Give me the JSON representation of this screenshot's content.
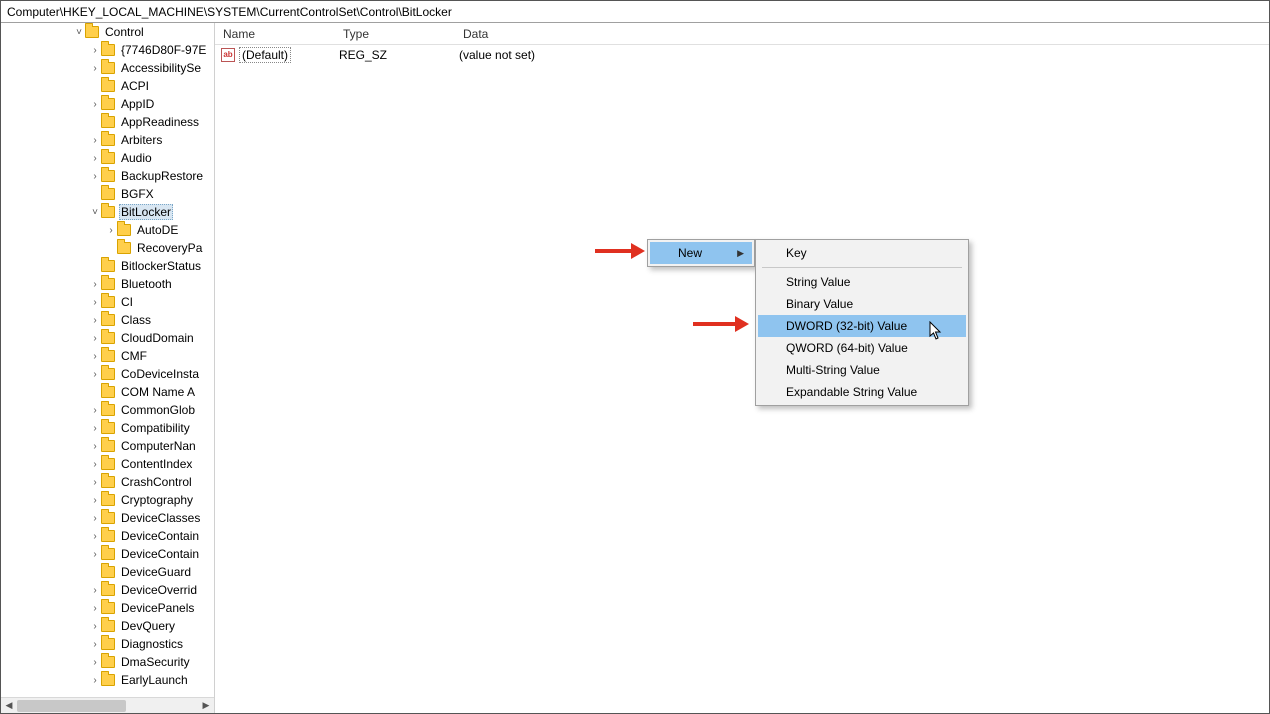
{
  "address": "Computer\\HKEY_LOCAL_MACHINE\\SYSTEM\\CurrentControlSet\\Control\\BitLocker",
  "tree": {
    "root_label": "Control",
    "selected_label": "BitLocker",
    "items": [
      {
        "label": "{7746D80F-97E",
        "depth": 3,
        "expand": ">"
      },
      {
        "label": "AccessibilitySe",
        "depth": 3,
        "expand": ">"
      },
      {
        "label": "ACPI",
        "depth": 3,
        "expand": ""
      },
      {
        "label": "AppID",
        "depth": 3,
        "expand": ">"
      },
      {
        "label": "AppReadiness",
        "depth": 3,
        "expand": ""
      },
      {
        "label": "Arbiters",
        "depth": 3,
        "expand": ">"
      },
      {
        "label": "Audio",
        "depth": 3,
        "expand": ">"
      },
      {
        "label": "BackupRestore",
        "depth": 3,
        "expand": ">"
      },
      {
        "label": "BGFX",
        "depth": 3,
        "expand": ""
      },
      {
        "label": "BitLocker",
        "depth": 3,
        "expand": "v",
        "selected": true
      },
      {
        "label": "AutoDE",
        "depth": 4,
        "expand": ">"
      },
      {
        "label": "RecoveryPa",
        "depth": 4,
        "expand": ""
      },
      {
        "label": "BitlockerStatus",
        "depth": 3,
        "expand": ""
      },
      {
        "label": "Bluetooth",
        "depth": 3,
        "expand": ">"
      },
      {
        "label": "CI",
        "depth": 3,
        "expand": ">"
      },
      {
        "label": "Class",
        "depth": 3,
        "expand": ">"
      },
      {
        "label": "CloudDomain",
        "depth": 3,
        "expand": ">"
      },
      {
        "label": "CMF",
        "depth": 3,
        "expand": ">"
      },
      {
        "label": "CoDeviceInsta",
        "depth": 3,
        "expand": ">"
      },
      {
        "label": "COM Name A",
        "depth": 3,
        "expand": ""
      },
      {
        "label": "CommonGlob",
        "depth": 3,
        "expand": ">"
      },
      {
        "label": "Compatibility",
        "depth": 3,
        "expand": ">"
      },
      {
        "label": "ComputerNan",
        "depth": 3,
        "expand": ">"
      },
      {
        "label": "ContentIndex",
        "depth": 3,
        "expand": ">"
      },
      {
        "label": "CrashControl",
        "depth": 3,
        "expand": ">"
      },
      {
        "label": "Cryptography",
        "depth": 3,
        "expand": ">"
      },
      {
        "label": "DeviceClasses",
        "depth": 3,
        "expand": ">"
      },
      {
        "label": "DeviceContain",
        "depth": 3,
        "expand": ">"
      },
      {
        "label": "DeviceContain",
        "depth": 3,
        "expand": ">"
      },
      {
        "label": "DeviceGuard",
        "depth": 3,
        "expand": ""
      },
      {
        "label": "DeviceOverrid",
        "depth": 3,
        "expand": ">"
      },
      {
        "label": "DevicePanels",
        "depth": 3,
        "expand": ">"
      },
      {
        "label": "DevQuery",
        "depth": 3,
        "expand": ">"
      },
      {
        "label": "Diagnostics",
        "depth": 3,
        "expand": ">"
      },
      {
        "label": "DmaSecurity",
        "depth": 3,
        "expand": ">"
      },
      {
        "label": "EarlyLaunch",
        "depth": 3,
        "expand": ">"
      }
    ]
  },
  "list": {
    "headers": {
      "name": "Name",
      "type": "Type",
      "data": "Data"
    },
    "rows": [
      {
        "name": "(Default)",
        "type": "REG_SZ",
        "data": "(value not set)",
        "icon": "ab"
      }
    ]
  },
  "context_menu_1": {
    "items": [
      {
        "label": "New",
        "has_submenu": true,
        "highlight": true
      }
    ]
  },
  "context_menu_2": {
    "items": [
      {
        "label": "Key"
      },
      {
        "sep": true
      },
      {
        "label": "String Value"
      },
      {
        "label": "Binary Value"
      },
      {
        "label": "DWORD (32-bit) Value",
        "highlight": true
      },
      {
        "label": "QWORD (64-bit) Value"
      },
      {
        "label": "Multi-String Value"
      },
      {
        "label": "Expandable String Value"
      }
    ]
  },
  "annotation_arrows": [
    "arrow-to-new",
    "arrow-to-dword"
  ]
}
